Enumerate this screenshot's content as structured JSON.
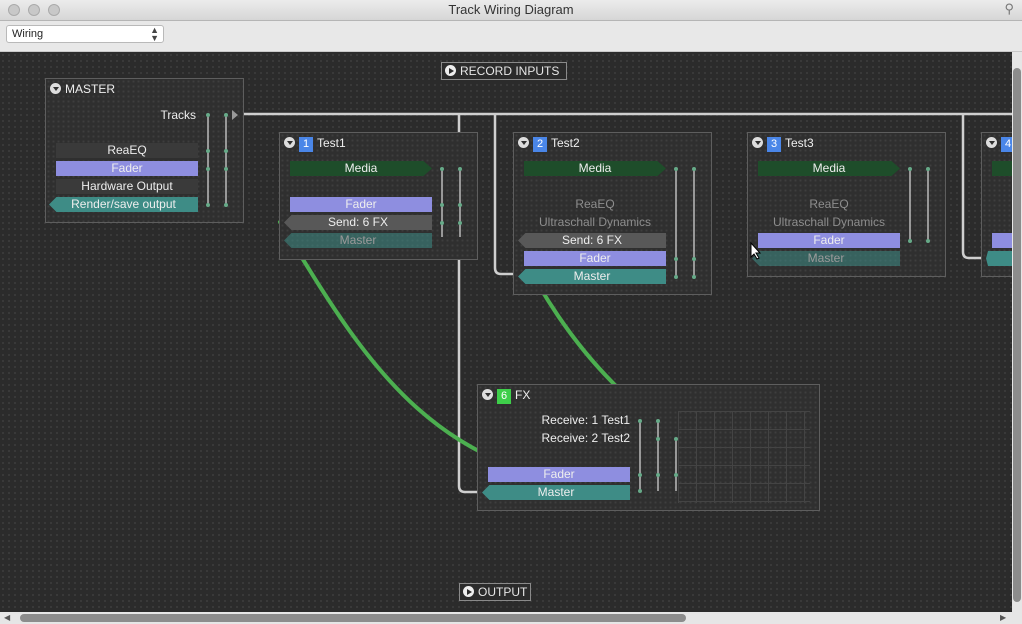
{
  "window": {
    "title": "Track Wiring Diagram"
  },
  "toolbar": {
    "view_select": "Wiring"
  },
  "canvas": {
    "record_inputs": "RECORD INPUTS",
    "output": "OUTPUT"
  },
  "master": {
    "title": "MASTER",
    "tracks_label": "Tracks",
    "reaeq": "ReaEQ",
    "fader": "Fader",
    "hardware_output": "Hardware Output",
    "render_output": "Render/save output"
  },
  "test1": {
    "number": "1",
    "name": "Test1",
    "media": "Media",
    "fader": "Fader",
    "send": "Send: 6 FX",
    "master": "Master",
    "color": "#4a86e8"
  },
  "test2": {
    "number": "2",
    "name": "Test2",
    "media": "Media",
    "reaeq": "ReaEQ",
    "dynamics": "Ultraschall Dynamics",
    "send": "Send: 6 FX",
    "fader": "Fader",
    "master": "Master",
    "color": "#4a86e8"
  },
  "test3": {
    "number": "3",
    "name": "Test3",
    "media": "Media",
    "reaeq": "ReaEQ",
    "dynamics": "Ultraschall Dynamics",
    "fader": "Fader",
    "master": "Master",
    "color": "#4a86e8"
  },
  "test4": {
    "number": "4",
    "color": "#4a86e8"
  },
  "fx": {
    "number": "6",
    "name": "FX",
    "receive1": "Receive: 1 Test1",
    "receive2": "Receive: 2 Test2",
    "fader": "Fader",
    "master": "Master",
    "color": "#3ecf4a"
  },
  "colors": {
    "wire": "#4caf50",
    "bus": "#cfcfcf",
    "fader": "#8e8ee0",
    "master": "#3e8c86",
    "media": "#1e4d2a"
  }
}
